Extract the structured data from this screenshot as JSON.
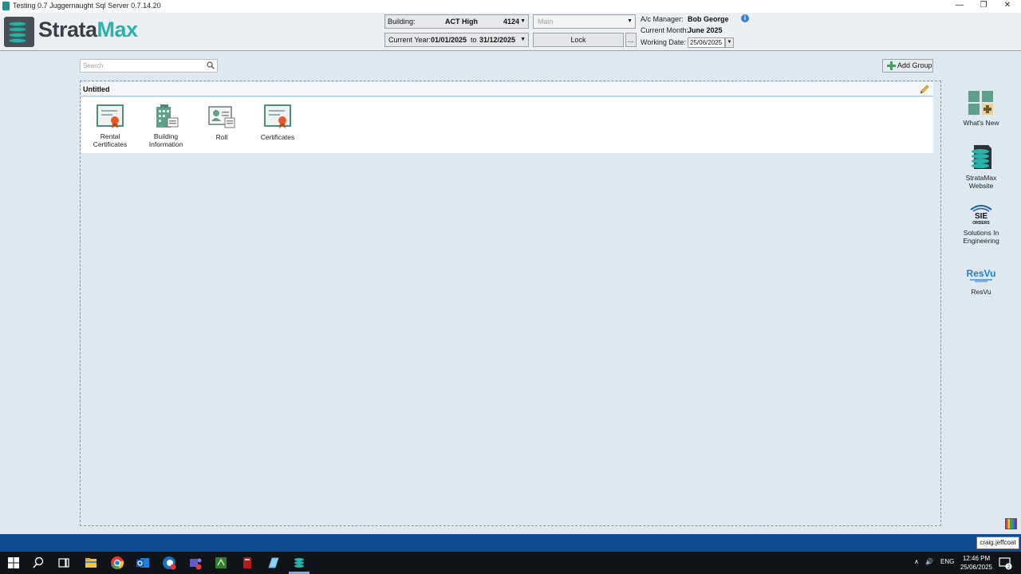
{
  "window": {
    "title": "Testing 0.7 Juggernaught Sql Server 0.7.14.20",
    "minimize": "—",
    "restore": "❐",
    "close": "✕"
  },
  "header": {
    "logo_part1": "Strata",
    "logo_part2": "Max",
    "building_label": "Building:",
    "building_name": "ACT High",
    "building_code": "4124",
    "ledger_select": "Main",
    "year_label": "Current Year:",
    "year_from": "01/01/2025",
    "year_to_word": "to",
    "year_to": "31/12/2025",
    "lock_label": "Lock",
    "more_label": "...",
    "manager_label": "A/c Manager:",
    "manager_value": "Bob George",
    "month_label": "Current Month:",
    "month_value": "June 2025",
    "working_label": "Working Date:",
    "working_value": "25/06/2025",
    "info_glyph": "i"
  },
  "toolbar": {
    "search_placeholder": "Search",
    "add_group_label": "Add Group"
  },
  "group": {
    "title": "Untitled",
    "tiles": [
      {
        "line1": "Rental",
        "line2": "Certificates"
      },
      {
        "line1": "Building",
        "line2": "Information"
      },
      {
        "line1": "Roll",
        "line2": ""
      },
      {
        "line1": "Certificates",
        "line2": ""
      }
    ]
  },
  "rail": [
    {
      "line1": "What's New",
      "line2": ""
    },
    {
      "line1": "StrataMax",
      "line2": "Website"
    },
    {
      "line1": "Solutions In",
      "line2": "Engineering"
    },
    {
      "line1": "ResVu",
      "line2": ""
    }
  ],
  "rail_logos": {
    "sie": "SIE",
    "sie_sub": "ORDERS",
    "resvu": "ResVu"
  },
  "status": {
    "user": "craig.jeffcoat"
  },
  "taskbar": {
    "lang": "ENG",
    "time": "12:46 PM",
    "date": "25/06/2025",
    "notif_count": "2"
  },
  "colors": {
    "brand_teal": "#2ab2ac",
    "brand_dark": "#3a3f45",
    "status_blue": "#0e4b93"
  }
}
